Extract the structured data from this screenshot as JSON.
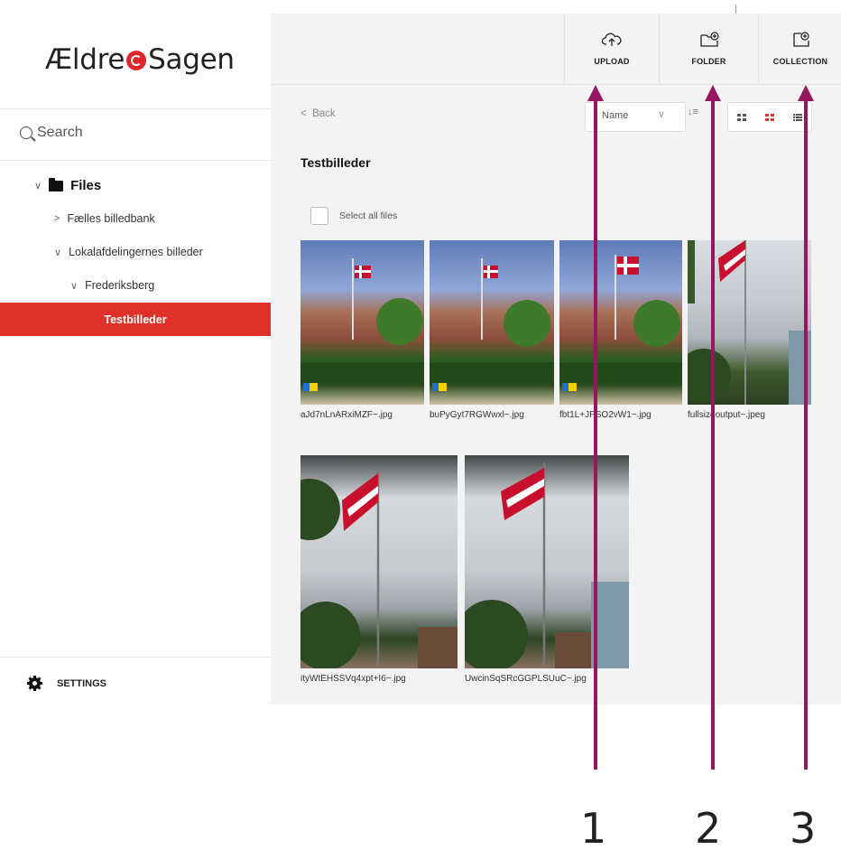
{
  "brand": {
    "name_part1": "Ældre",
    "name_part2": "Sagen",
    "accent": "#e0302a"
  },
  "sidebar": {
    "search_placeholder": "Search",
    "tree": {
      "root": "Files",
      "items": [
        {
          "label": "Fælles billedbank",
          "expanded": false
        },
        {
          "label": "Lokalafdelingernes billeder",
          "expanded": true
        },
        {
          "label": "Frederiksberg",
          "expanded": true
        }
      ],
      "active": "Testbilleder"
    },
    "settings_label": "SETTINGS"
  },
  "toolbar": {
    "upload_label": "UPLOAD",
    "folder_label": "FOLDER",
    "collection_label": "COLLECTION"
  },
  "main": {
    "back_label": "Back",
    "sort_value": "Name",
    "folder_title": "Testbilleder",
    "select_all_label": "Select all files",
    "files": [
      {
        "name": "aJd7nLnARxiMZF~.jpg"
      },
      {
        "name": "buPyGyt7RGWwxl~.jpg"
      },
      {
        "name": "fbt1L+JPSO2vW1~.jpg"
      },
      {
        "name": "fullsizeoutput~.jpeg"
      },
      {
        "name": "ityWtEHSSVq4xpt+I6~.jpg"
      },
      {
        "name": "UwcinSqSRcGGPLSUuC~.jpg"
      }
    ]
  },
  "annotations": {
    "labels": [
      "1",
      "2",
      "3"
    ],
    "color": "#96165f"
  }
}
